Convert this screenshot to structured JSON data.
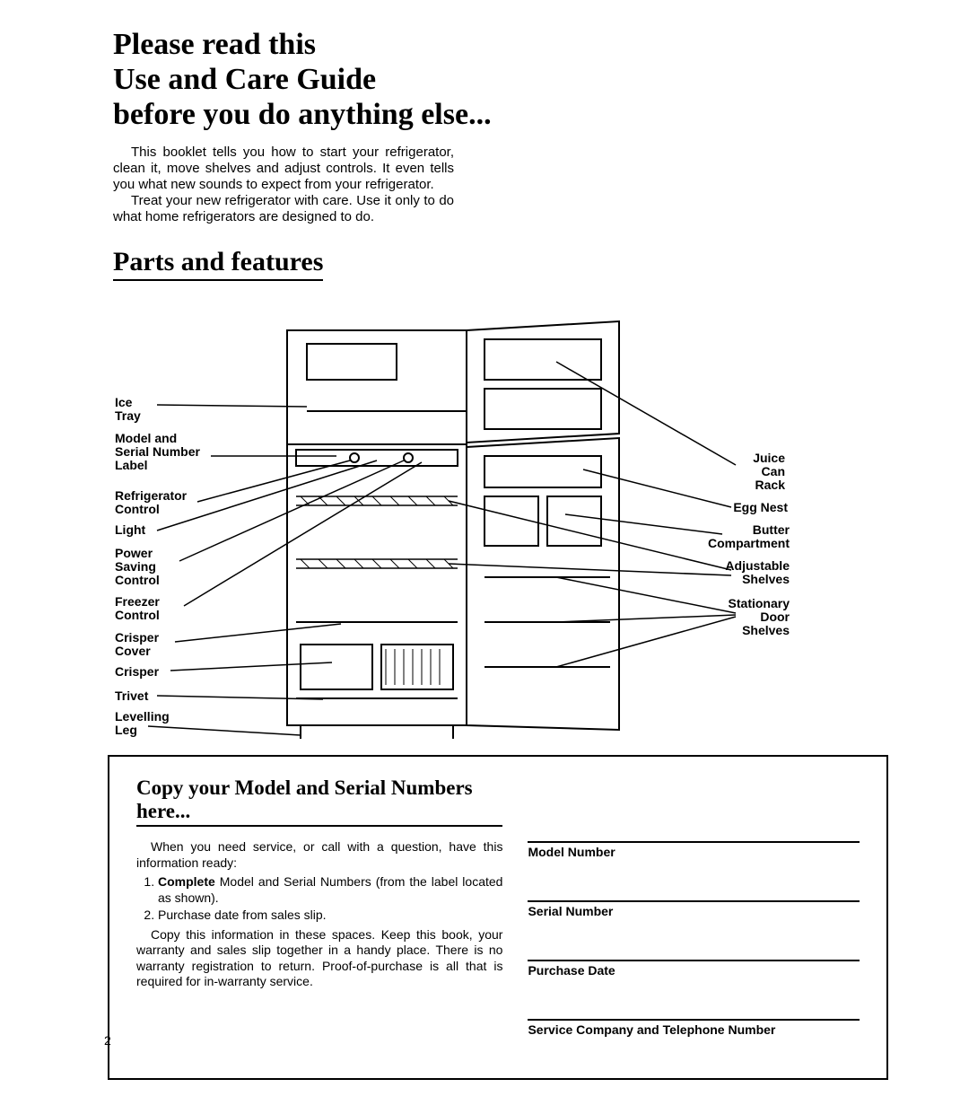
{
  "heading": {
    "line1": "Please read this",
    "line2": "Use and Care Guide",
    "line3": "before you do anything else..."
  },
  "intro": {
    "p1": "This booklet tells you how to start your refrigerator, clean it, move shelves and adjust controls. It even tells you what new sounds to expect from your refrigerator.",
    "p2": "Treat your new refrigerator with care. Use it only to do what home refrigerators are designed to do."
  },
  "subheading": "Parts and features",
  "labels": {
    "left": {
      "ice_tray": "Ice\nTray",
      "model_serial": "Model and\nSerial Number\nLabel",
      "refrig_control": "Refrigerator\nControl",
      "light": "Light",
      "power_saving": "Power\nSaving\nControl",
      "freezer_control": "Freezer\nControl",
      "crisper_cover": "Crisper\nCover",
      "crisper": "Crisper",
      "trivet": "Trivet",
      "levelling_leg": "Levelling\nLeg"
    },
    "right": {
      "juice_can_rack": "Juice\nCan\nRack",
      "egg_nest": "Egg Nest",
      "butter_comp": "Butter\nCompartment",
      "adj_shelves": "Adjustable\nShelves",
      "door_shelves": "Stationary\nDoor\nShelves"
    }
  },
  "info": {
    "heading": "Copy your Model and Serial Numbers here...",
    "p1": "When you need service, or call with a question, have this information ready:",
    "li1_pre": "Complete",
    "li1_post": " Model and Serial Numbers (from the label located as shown).",
    "li2": "Purchase date from sales slip.",
    "p2": "Copy this information in these spaces. Keep this book, your warranty and sales slip together in a handy place. There is no warranty registration to return. Proof-of-purchase is all that is required for in-warranty service.",
    "fields": {
      "model": "Model Number",
      "serial": "Serial Number",
      "purchase": "Purchase Date",
      "service": "Service Company and Telephone Number"
    }
  },
  "page_number": "2"
}
